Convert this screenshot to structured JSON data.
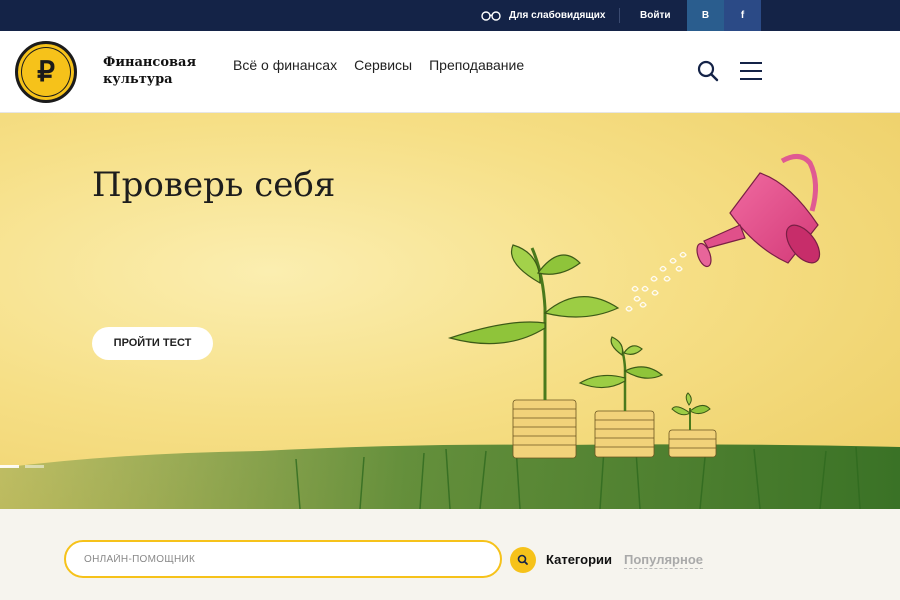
{
  "topbar": {
    "a11y_label": "Для слабовидящих",
    "login_label": "Войти",
    "social": [
      {
        "label": "В",
        "icon": "vk-icon"
      },
      {
        "label": "f",
        "icon": "facebook-icon"
      }
    ],
    "bg_color": "#142347"
  },
  "header": {
    "logo_symbol": "₽",
    "logo_text_line1": "Финансовая",
    "logo_text_line2": "культура",
    "nav": [
      "Всё о финансах",
      "Сервисы",
      "Преподавание"
    ]
  },
  "hero": {
    "title": "Проверь себя",
    "cta_label": "ПРОЙТИ ТЕСТ",
    "slides_total": 2,
    "active_slide": 1
  },
  "search": {
    "placeholder": "ОНЛАЙН-ПОМОЩНИК",
    "tabs": [
      "Категории",
      "Популярное"
    ],
    "active_tab": "Категории"
  },
  "colors": {
    "accent": "#f6c21a",
    "navy": "#142347",
    "watering_can": "#ea4f8c",
    "grass": "#3f7a2a"
  }
}
